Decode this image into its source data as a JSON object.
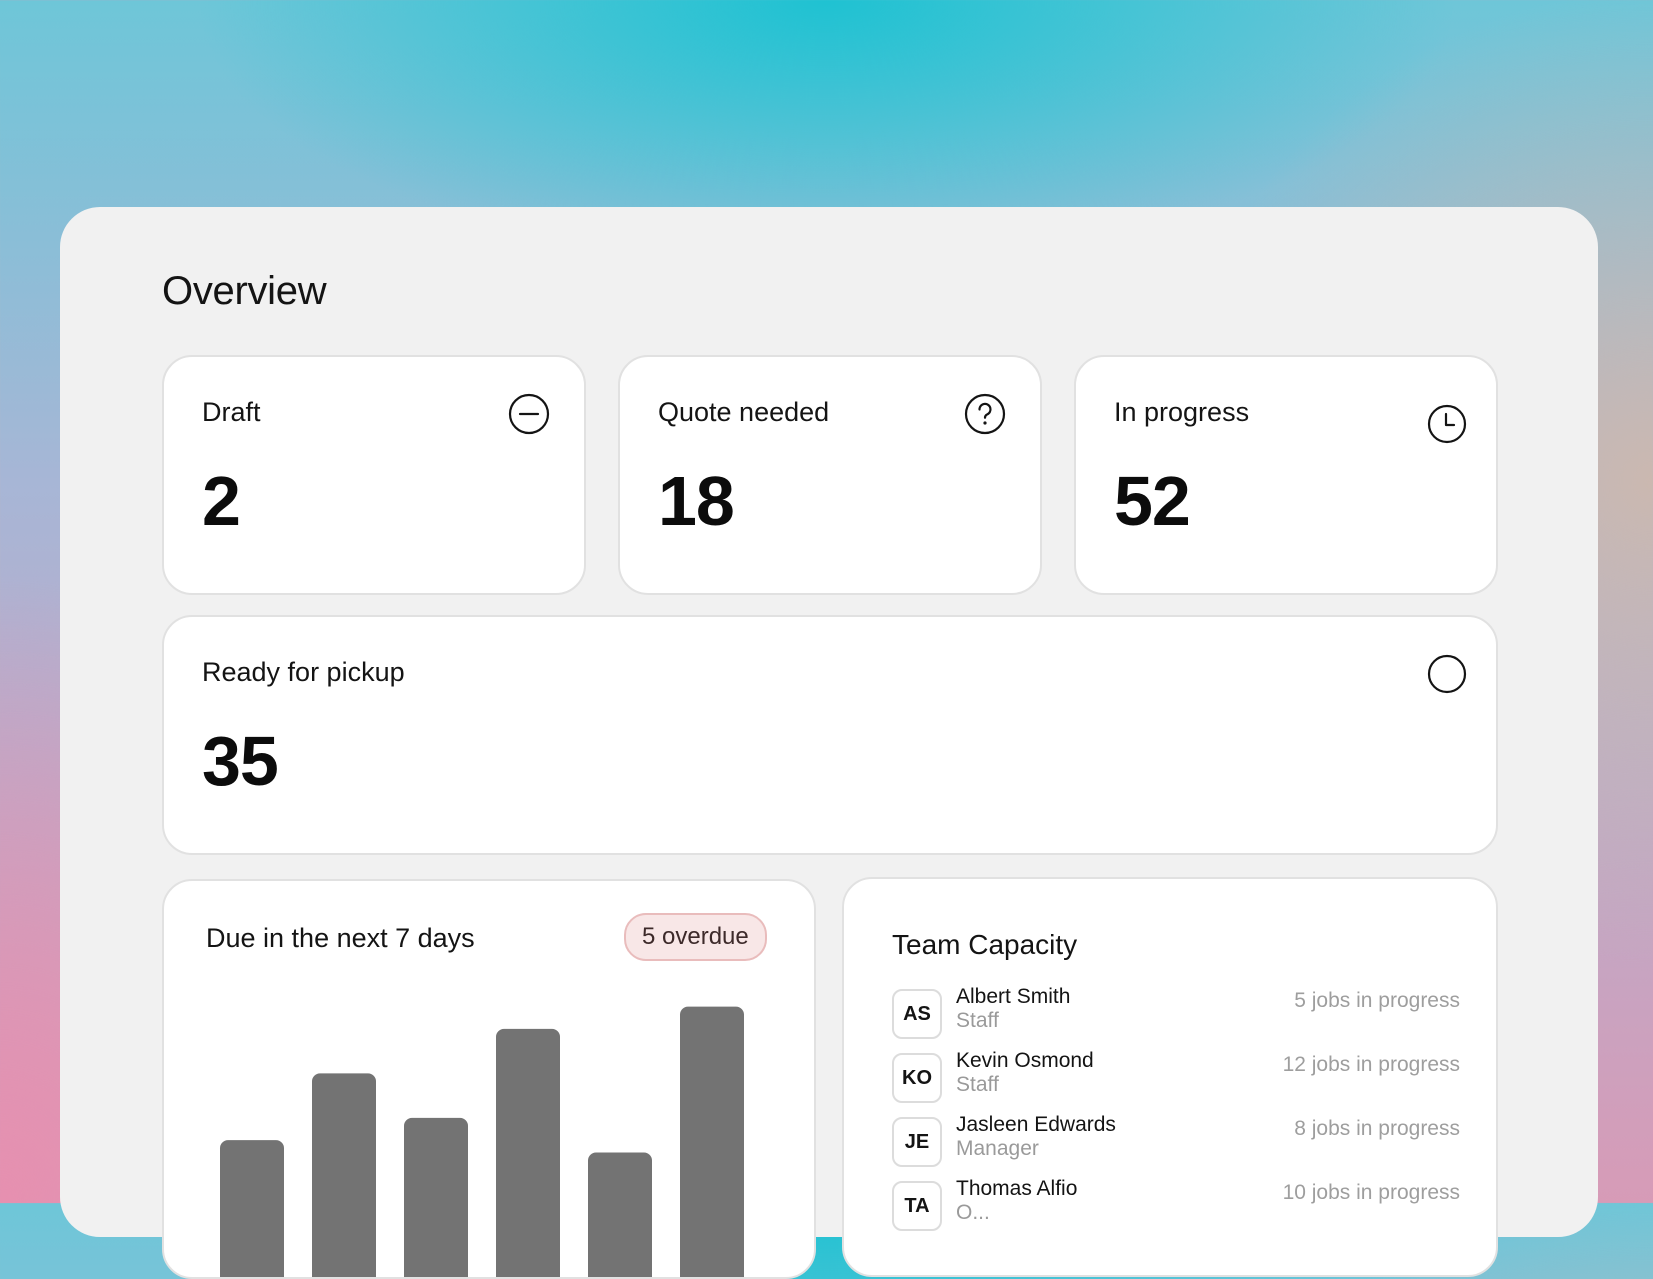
{
  "page_title": "Overview",
  "stats": [
    {
      "label": "Draft",
      "value": "2",
      "icon": "minus-circle-icon"
    },
    {
      "label": "Quote needed",
      "value": "18",
      "icon": "question-circle-icon"
    },
    {
      "label": "In progress",
      "value": "52",
      "icon": "clock-icon"
    },
    {
      "label": "Ready for pickup",
      "value": "35",
      "icon": "empty-circle-icon"
    }
  ],
  "due": {
    "title": "Due in the next 7 days",
    "badge": "5 overdue",
    "bar_color": "#737373"
  },
  "chart_data": {
    "type": "bar",
    "values": [
      57,
      84,
      66,
      102,
      52,
      111
    ],
    "ylim": [
      0,
      115
    ]
  },
  "team": {
    "title": "Team Capacity",
    "members": [
      {
        "initials": "AS",
        "name": "Albert Smith",
        "role": "Staff",
        "jobs": "5 jobs in progress"
      },
      {
        "initials": "KO",
        "name": "Kevin Osmond",
        "role": "Staff",
        "jobs": "12 jobs in progress"
      },
      {
        "initials": "JE",
        "name": "Jasleen Edwards",
        "role": "Manager",
        "jobs": "8 jobs in progress"
      },
      {
        "initials": "TA",
        "name": "Thomas Alfio",
        "role": "O...",
        "jobs": "10 jobs in progress"
      }
    ]
  }
}
